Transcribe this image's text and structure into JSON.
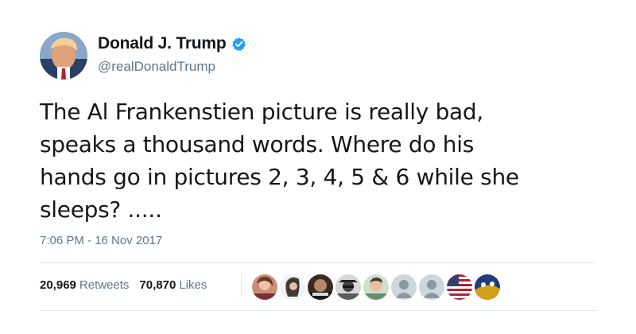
{
  "author": {
    "display_name": "Donald J. Trump",
    "handle": "@realDonaldTrump",
    "verified": true,
    "verified_color": "#1da1f2"
  },
  "tweet": {
    "text": "The Al Frankenstien picture is really bad,\nspeaks a thousand words. Where do his\nhands go in pictures 2, 3, 4, 5 & 6 while she\nsleeps? .....",
    "timestamp": "7:06 PM - 16 Nov 2017"
  },
  "stats": {
    "retweets_count": "20,969",
    "retweets_label": "Retweets",
    "likes_count": "70,870",
    "likes_label": "Likes"
  },
  "liker_avatars": [
    {
      "icon": "user-avatar-photo"
    },
    {
      "icon": "user-avatar-photo"
    },
    {
      "icon": "user-avatar-photo"
    },
    {
      "icon": "user-avatar-photo"
    },
    {
      "icon": "user-avatar-photo"
    },
    {
      "icon": "default-avatar-icon"
    },
    {
      "icon": "default-avatar-icon"
    },
    {
      "icon": "flag-avatar"
    },
    {
      "icon": "user-avatar-photo"
    }
  ],
  "colors": {
    "text_primary": "#14171a",
    "text_secondary": "#657786",
    "divider": "#e1e8ed"
  }
}
